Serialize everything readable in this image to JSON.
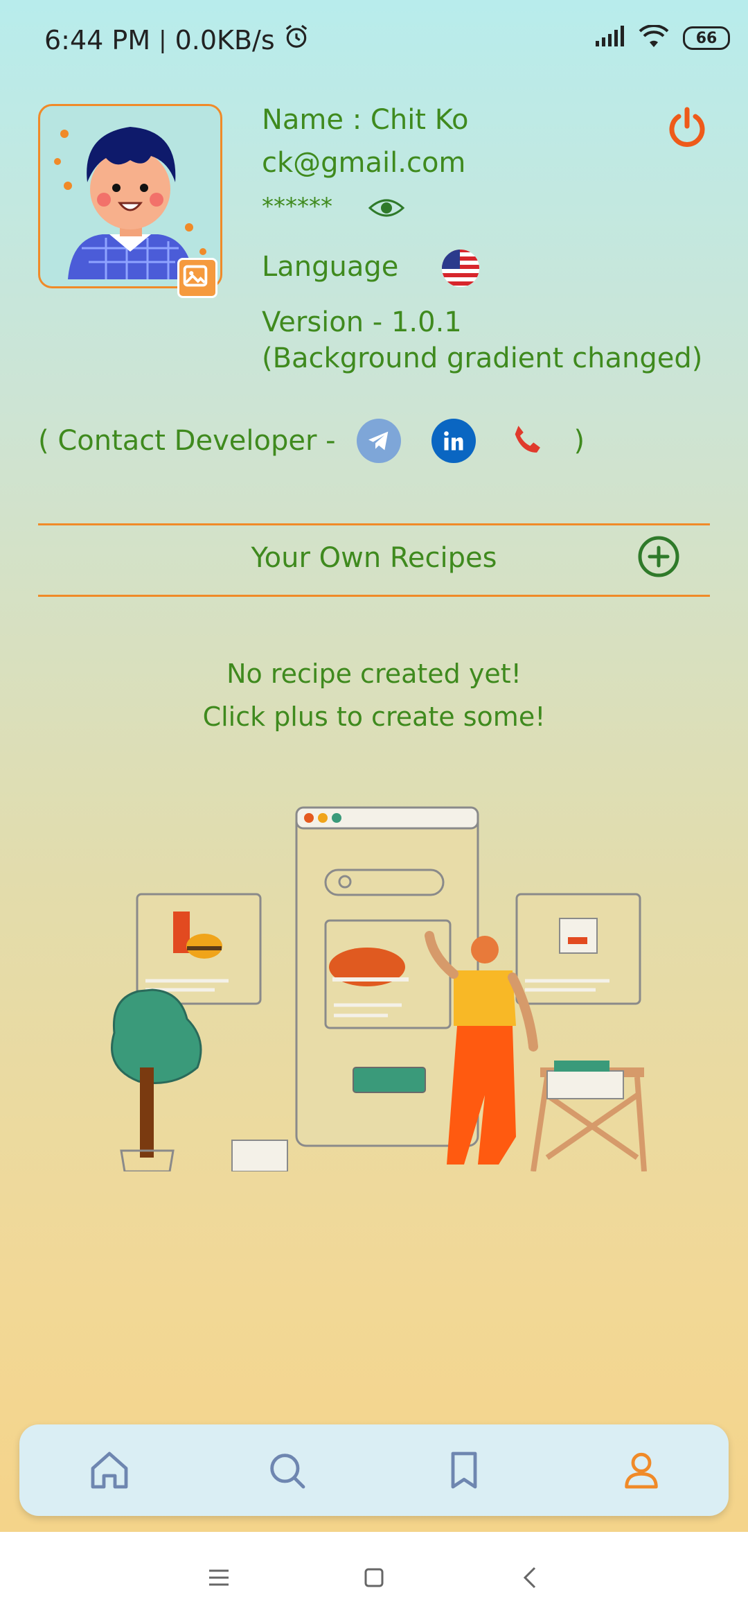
{
  "status_bar": {
    "time": "6:44 PM",
    "network_speed": "0.0KB/s",
    "battery": "66",
    "icons": [
      "alarm-icon",
      "signal-icon",
      "wifi-icon",
      "battery-icon"
    ]
  },
  "profile": {
    "name": "Name : Chit Ko",
    "email": "ck@gmail.com",
    "password_mask": "******",
    "language_label": "Language",
    "version": "Version - 1.0.1",
    "version_note": "(Background gradient changed)"
  },
  "contact": {
    "prefix": "( Contact Developer -",
    "suffix": ")",
    "icons": [
      "telegram-icon",
      "linkedin-icon",
      "phone-icon"
    ]
  },
  "recipes": {
    "title": "Your Own Recipes",
    "empty_line1": "No recipe created yet!",
    "empty_line2": "Click plus to create some!"
  },
  "nav": {
    "items": [
      "home-icon",
      "search-icon",
      "bookmark-icon",
      "profile-icon"
    ],
    "active": "profile-icon"
  },
  "colors": {
    "accent": "#f08a28",
    "text_green": "#3f8a1e",
    "nav_inactive": "#6e86b0"
  }
}
